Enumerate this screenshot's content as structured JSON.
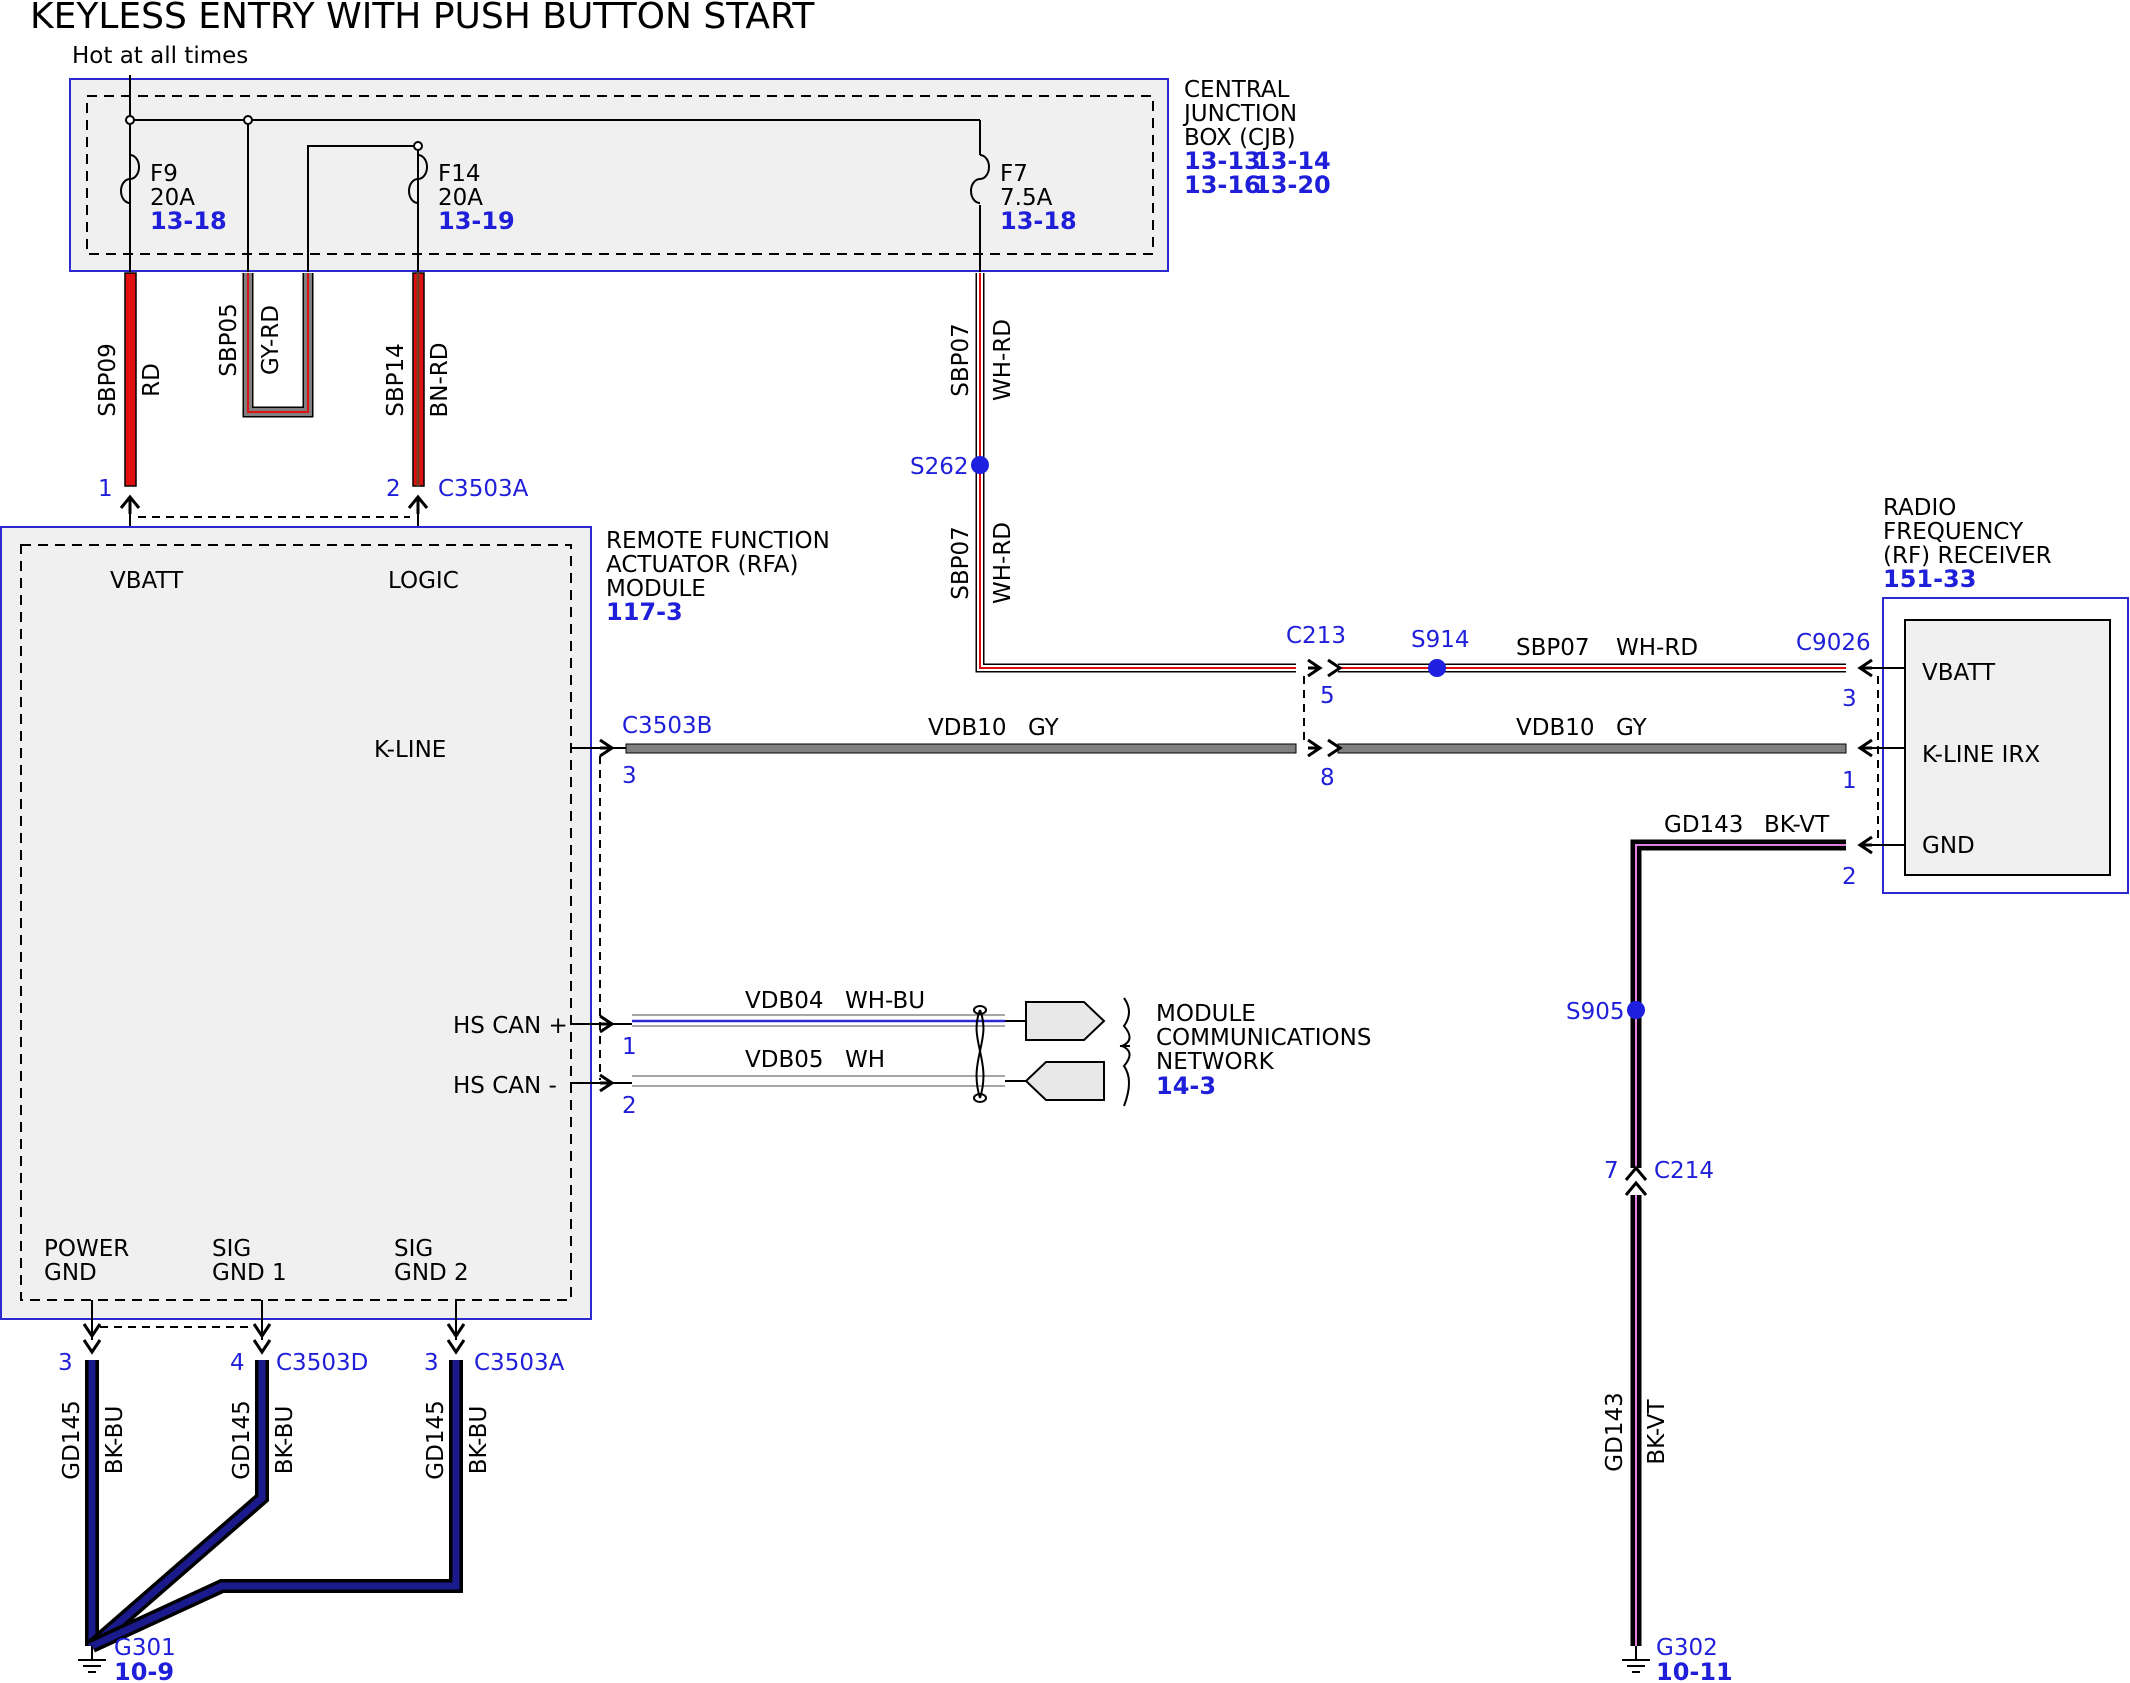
{
  "title": "KEYLESS ENTRY WITH PUSH BUTTON START",
  "hot_label": "Hot at all times",
  "cjb": {
    "name_lines": [
      "CENTRAL",
      "JUNCTION",
      "BOX (CJB)"
    ],
    "ref1a": "13-13",
    "ref1b": "13-14",
    "ref2a": "13-16",
    "ref2b": "13-20"
  },
  "fuses": {
    "f9": {
      "name": "F9",
      "rating": "20A",
      "ref": "13-18"
    },
    "f14": {
      "name": "F14",
      "rating": "20A",
      "ref": "13-19"
    },
    "f7": {
      "name": "F7",
      "rating": "7.5A",
      "ref": "13-18"
    }
  },
  "wires": {
    "sbp09": {
      "circuit": "SBP09",
      "color": "RD"
    },
    "sbp05": {
      "circuit": "SBP05",
      "color": "GY-RD"
    },
    "sbp14": {
      "circuit": "SBP14",
      "color": "BN-RD"
    },
    "sbp07": {
      "circuit": "SBP07",
      "color": "WH-RD"
    },
    "vdb10": {
      "circuit": "VDB10",
      "color": "GY"
    },
    "vdb04": {
      "circuit": "VDB04",
      "color": "WH-BU"
    },
    "vdb05": {
      "circuit": "VDB05",
      "color": "WH"
    },
    "gd143": {
      "circuit": "GD143",
      "color": "BK-VT"
    },
    "gd145": {
      "circuit": "GD145",
      "color": "BK-BU"
    }
  },
  "splices": {
    "s262": "S262",
    "s914": "S914",
    "s905": "S905"
  },
  "connectors": {
    "c3503a": "C3503A",
    "c3503b": "C3503B",
    "c3503d": "C3503D",
    "c213": "C213",
    "c9026": "C9026",
    "c214": "C214"
  },
  "pins": {
    "top_vbatt": "1",
    "top_logic": "2",
    "kline_rfa": "3",
    "hscan_plus": "1",
    "hscan_minus": "2",
    "c213_vbatt": "5",
    "c213_kline": "8",
    "rf_vbatt": "3",
    "rf_kline": "1",
    "rf_gnd": "2",
    "c214": "7",
    "pgnd": "3",
    "sig1": "4",
    "sig2": "3"
  },
  "rfa": {
    "name_lines": [
      "REMOTE FUNCTION",
      "ACTUATOR (RFA)",
      "MODULE"
    ],
    "ref": "117-3",
    "vbatt": "VBATT",
    "logic": "LOGIC",
    "kline": "K-LINE",
    "hscan_plus": "HS CAN +",
    "hscan_minus": "HS CAN -",
    "power_gnd_lines": [
      "POWER",
      "GND"
    ],
    "sig_gnd1_lines": [
      "SIG",
      "GND 1"
    ],
    "sig_gnd2_lines": [
      "SIG",
      "GND 2"
    ]
  },
  "rf": {
    "name_lines": [
      "RADIO",
      "FREQUENCY",
      "(RF) RECEIVER"
    ],
    "ref": "151-33",
    "vbatt": "VBATT",
    "kline": "K-LINE IRX",
    "gnd": "GND"
  },
  "mcn": {
    "name_lines": [
      "MODULE",
      "COMMUNICATIONS",
      "NETWORK"
    ],
    "ref": "14-3"
  },
  "grounds": {
    "g301": {
      "name": "G301",
      "ref": "10-9"
    },
    "g302": {
      "name": "G302",
      "ref": "10-11"
    }
  },
  "colors": {
    "link": "#1f1fd9",
    "red_wire": "#e01010",
    "gray_wire": "#808080",
    "ground_wire": "#1a1a8c",
    "box_fill": "#f0f0f0"
  }
}
